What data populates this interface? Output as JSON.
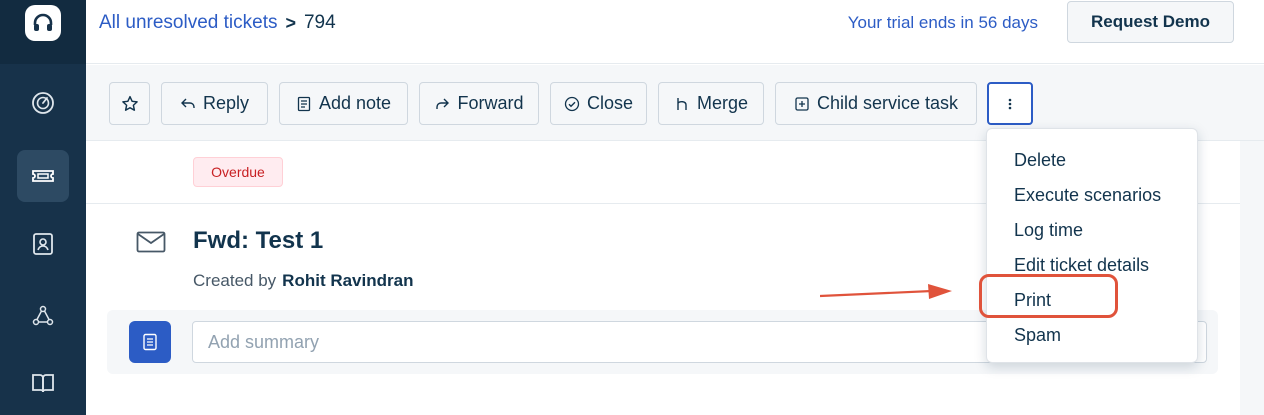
{
  "sidebar": {
    "logo_icon": "headset-icon",
    "items": [
      {
        "icon": "dashboard-icon",
        "active": false
      },
      {
        "icon": "ticket-icon",
        "active": true
      },
      {
        "icon": "contact-icon",
        "active": false
      },
      {
        "icon": "network-icon",
        "active": false
      },
      {
        "icon": "book-icon",
        "active": false
      }
    ]
  },
  "header": {
    "breadcrumb_link": "All unresolved tickets",
    "breadcrumb_sep": ">",
    "ticket_id": "794",
    "trial_text": "Your trial ends in 56 days",
    "demo_button": "Request Demo"
  },
  "toolbar": {
    "star_icon": "star-icon",
    "reply": "Reply",
    "add_note": "Add note",
    "forward": "Forward",
    "close": "Close",
    "merge": "Merge",
    "child_task": "Child service task",
    "more_icon": "vertical-dots-icon"
  },
  "ticket": {
    "status_badge": "Overdue",
    "subject": "Fwd: Test 1",
    "created_by_label": "Created by",
    "author": "Rohit Ravindran",
    "summary_placeholder": "Add summary"
  },
  "menu": {
    "items": [
      "Delete",
      "Execute scenarios",
      "Log time",
      "Edit ticket details",
      "Print",
      "Spam"
    ],
    "highlighted": "Print"
  },
  "colors": {
    "sidebar": "#17324a",
    "accent": "#2c5cc5",
    "overdue": "#c82124",
    "annotation": "#e0533b"
  }
}
